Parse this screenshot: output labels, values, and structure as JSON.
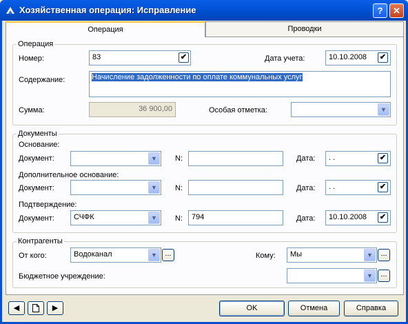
{
  "window": {
    "title": "Хозяйственная операция: Исправление",
    "help_glyph": "?",
    "close_glyph": "✕"
  },
  "tabs": [
    {
      "label": "Операция",
      "active": true
    },
    {
      "label": "Проводки",
      "active": false
    }
  ],
  "operation": {
    "group_title": "Операция",
    "number_label": "Номер:",
    "number_value": "83",
    "date_label": "Дата учета:",
    "date_value": "10.10.2008",
    "content_label": "Содержание:",
    "content_value": "Начисление задолженности по оплате коммунальных услуг",
    "sum_label": "Сумма:",
    "sum_value": "36 900,00",
    "mark_label": "Особая отметка:",
    "mark_value": ""
  },
  "documents": {
    "group_title": "Документы",
    "rows": [
      {
        "section_label": "Основание:",
        "doc_label": "Документ:",
        "doc_value": "",
        "n_label": "N:",
        "n_value": "",
        "date_label": "Дата:",
        "date_value": " .  ."
      },
      {
        "section_label": "Дополнительное основание:",
        "doc_label": "Документ:",
        "doc_value": "",
        "n_label": "N:",
        "n_value": "",
        "date_label": "Дата:",
        "date_value": " .  ."
      },
      {
        "section_label": "Подтверждение:",
        "doc_label": "Документ:",
        "doc_value": "СЧФК",
        "n_label": "N:",
        "n_value": "794",
        "date_label": "Дата:",
        "date_value": "10.10.2008"
      }
    ]
  },
  "counterparts": {
    "group_title": "Контрагенты",
    "from_label": "От кого:",
    "from_value": "Водоканал",
    "to_label": "Кому:",
    "to_value": "Мы",
    "budget_label": "Бюджетное учреждение:",
    "budget_value": ""
  },
  "footer": {
    "ok_label": "OK",
    "cancel_label": "Отмена",
    "help_label": "Справка"
  },
  "glyphs": {
    "check": "✔",
    "dropdown": "▼",
    "ellipsis": "...",
    "prev": "◀",
    "next": "▶"
  },
  "colors": {
    "titlebar": "#0052d6",
    "dialog_bg": "#ece9d8",
    "panel_bg": "#fcfcfe",
    "selection": "#316ac5",
    "tab_highlight": "#ffc83c"
  }
}
